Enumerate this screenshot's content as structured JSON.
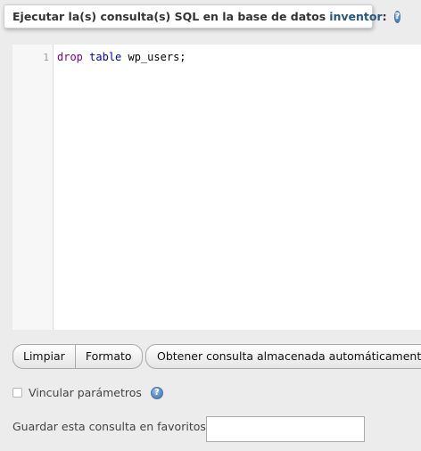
{
  "header": {
    "title_prefix": "Ejecutar la(s) consulta(s) SQL en la base de datos",
    "database_name": "inventor",
    "title_suffix": ":",
    "help_icon": "help-icon"
  },
  "editor": {
    "line_numbers": [
      "1"
    ],
    "code_tokens": {
      "keyword1": "drop",
      "keyword2": "table",
      "rest": " wp_users;"
    }
  },
  "buttons": {
    "clear_label": "Limpiar",
    "format_label": "Formato",
    "autosave_label": "Obtener consulta almacenada automáticamente"
  },
  "bind_params": {
    "label": "Vincular parámetros",
    "checked": false
  },
  "favorites": {
    "label": "Guardar esta consulta en favoritos:",
    "value": ""
  }
}
